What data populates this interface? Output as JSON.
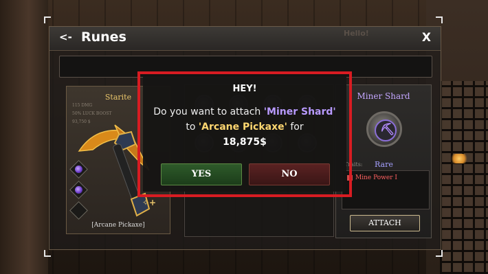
{
  "header": {
    "back_label": "<-",
    "title": "Runes",
    "close_label": "X",
    "faded_text": "Hello!"
  },
  "item_card": {
    "name": "Starite",
    "stats": [
      "115 DMG",
      "50% LUCK BOOST",
      "93,750 $"
    ],
    "label": "[Arcane Pickaxe]",
    "trait_icons": [
      "sparkle-icon",
      "plus-icon"
    ]
  },
  "rune_card": {
    "name": "Miner Shard",
    "traits_label": "Traits:",
    "rarity": "Rare",
    "trait": "Mine Power I",
    "attach_label": "ATTACH"
  },
  "modal": {
    "title": "HEY!",
    "text_prefix": "Do you want to attach ",
    "rune_name": "'Miner Shard'",
    "text_middle": " to ",
    "item_name": "'Arcane Pickaxe'",
    "text_suffix": " for",
    "price": "18,875$",
    "yes_label": "YES",
    "no_label": "NO"
  },
  "colors": {
    "highlight_border": "#d81c22",
    "rune_purple": "#b89aff",
    "item_gold": "#ffd770",
    "yes_green": "#2e5a2a",
    "no_red": "#5a2222"
  }
}
